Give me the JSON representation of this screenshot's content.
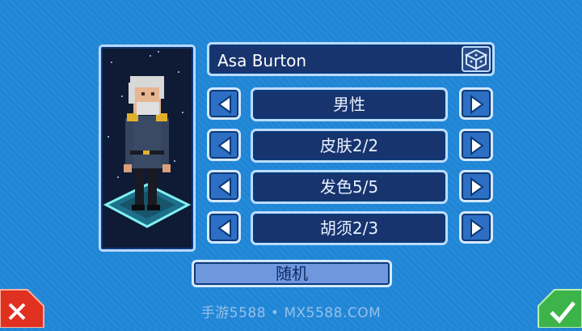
{
  "character": {
    "name": "Asa Burton"
  },
  "options": [
    {
      "label": "男性"
    },
    {
      "label": "皮肤2/2"
    },
    {
      "label": "发色5/5"
    },
    {
      "label": "胡须2/3"
    }
  ],
  "random_button": {
    "label": "随机"
  },
  "icons": {
    "randomize": "dice-icon",
    "prev": "arrow-left-icon",
    "next": "arrow-right-icon",
    "cancel": "close-icon",
    "confirm": "check-icon"
  },
  "watermark": "手游5588 • MX5588.COM",
  "colors": {
    "background": "#1f86d6",
    "panel": "#17346e",
    "border": "#bcdcff",
    "cancel": "#e0301f",
    "confirm": "#3cb44a"
  }
}
